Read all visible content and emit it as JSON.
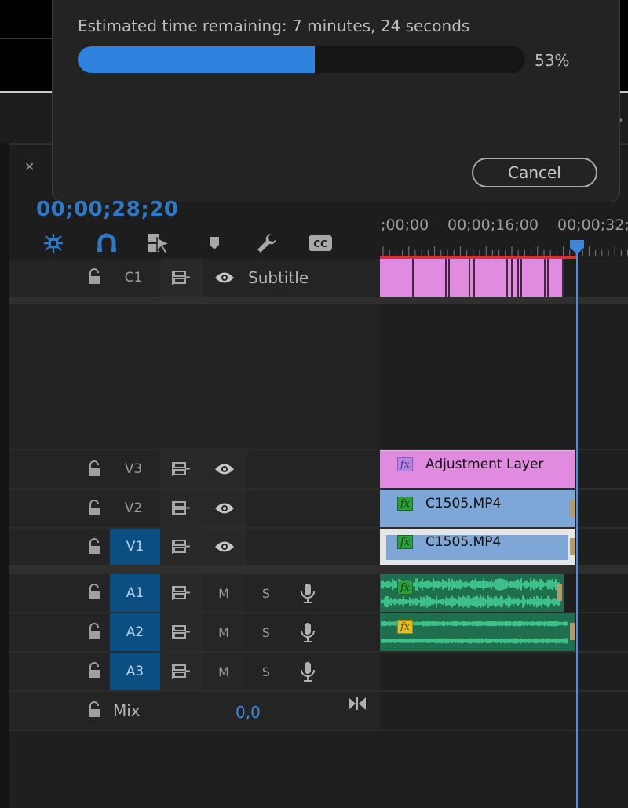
{
  "dialog": {
    "status_text": "Estimated time remaining: 7 minutes, 24 seconds",
    "progress": 0.53,
    "progress_label": "53%",
    "cancel_label": "Cancel"
  },
  "timeline": {
    "current_timecode": "00;00;28;20",
    "ruler_labels": [
      ";00;00",
      "00;00;16;00",
      "00;00;32;"
    ],
    "tools": [
      "nest-sequence-icon",
      "snap-magnet-icon",
      "linked-selection-icon",
      "add-marker-icon",
      "wrench-settings-icon",
      "captions-cc-icon"
    ],
    "tracks": {
      "c1": {
        "id": "C1",
        "name": "Subtitle"
      },
      "v3": {
        "id": "V3"
      },
      "v2": {
        "id": "V2"
      },
      "v1": {
        "id": "V1"
      },
      "a1": {
        "id": "A1",
        "m": "M",
        "s": "S"
      },
      "a2": {
        "id": "A2",
        "m": "M",
        "s": "S"
      },
      "a3": {
        "id": "A3",
        "m": "M",
        "s": "S"
      },
      "mix": {
        "label": "Mix",
        "value": "0,0"
      }
    },
    "clips": {
      "adjustment": "Adjustment Layer",
      "v2": "C1505.MP4",
      "v1": "C1505.MP4"
    },
    "fx_label": "fx"
  },
  "colors": {
    "accent_blue": "#2f83de",
    "subtitle_clip": "#e08ae0",
    "video_clip": "#7ea6d6",
    "audio_clip": "#2aa876",
    "track_target": "#0b4f82"
  }
}
